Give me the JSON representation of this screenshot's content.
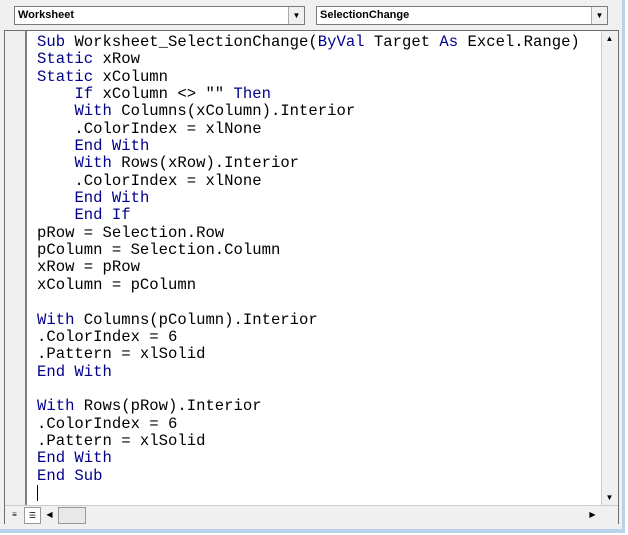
{
  "object_combo": {
    "value": "Worksheet"
  },
  "procedure_combo": {
    "value": "SelectionChange"
  },
  "code_lines": [
    [
      [
        "kw",
        "Sub "
      ],
      [
        "",
        "Worksheet_SelectionChange("
      ],
      [
        "kw",
        "ByVal"
      ],
      [
        "",
        " Target "
      ],
      [
        "kw",
        "As"
      ],
      [
        "",
        " Excel.Range)"
      ]
    ],
    [
      [
        "kw",
        "Static"
      ],
      [
        "",
        " xRow"
      ]
    ],
    [
      [
        "kw",
        "Static"
      ],
      [
        "",
        " xColumn"
      ]
    ],
    [
      [
        "",
        "    "
      ],
      [
        "kw",
        "If"
      ],
      [
        "",
        " xColumn <> \"\" "
      ],
      [
        "kw",
        "Then"
      ]
    ],
    [
      [
        "",
        "    "
      ],
      [
        "kw",
        "With"
      ],
      [
        "",
        " Columns(xColumn).Interior"
      ]
    ],
    [
      [
        "",
        "    .ColorIndex = xlNone"
      ]
    ],
    [
      [
        "",
        "    "
      ],
      [
        "kw",
        "End With"
      ]
    ],
    [
      [
        "",
        "    "
      ],
      [
        "kw",
        "With"
      ],
      [
        "",
        " Rows(xRow).Interior"
      ]
    ],
    [
      [
        "",
        "    .ColorIndex = xlNone"
      ]
    ],
    [
      [
        "",
        "    "
      ],
      [
        "kw",
        "End With"
      ]
    ],
    [
      [
        "",
        "    "
      ],
      [
        "kw",
        "End If"
      ]
    ],
    [
      [
        "",
        "pRow = Selection.Row"
      ]
    ],
    [
      [
        "",
        "pColumn = Selection.Column"
      ]
    ],
    [
      [
        "",
        "xRow = pRow"
      ]
    ],
    [
      [
        "",
        "xColumn = pColumn"
      ]
    ],
    [],
    [
      [
        "kw",
        "With"
      ],
      [
        "",
        " Columns(pColumn).Interior"
      ]
    ],
    [
      [
        "",
        ".ColorIndex = 6"
      ]
    ],
    [
      [
        "",
        ".Pattern = xlSolid"
      ]
    ],
    [
      [
        "kw",
        "End With"
      ]
    ],
    [],
    [
      [
        "kw",
        "With"
      ],
      [
        "",
        " Rows(pRow).Interior"
      ]
    ],
    [
      [
        "",
        ".ColorIndex = 6"
      ]
    ],
    [
      [
        "",
        ".Pattern = xlSolid"
      ]
    ],
    [
      [
        "kw",
        "End With"
      ]
    ],
    [
      [
        "kw",
        "End Sub"
      ]
    ]
  ],
  "colors": {
    "keyword": "#00008b",
    "text": "#000000"
  },
  "icons": {
    "dropdown": "▼",
    "scroll_up": "▲",
    "scroll_down": "▼",
    "scroll_left": "◀",
    "scroll_right": "▶",
    "procedure_view": "≡",
    "full_module_view": "☰"
  }
}
